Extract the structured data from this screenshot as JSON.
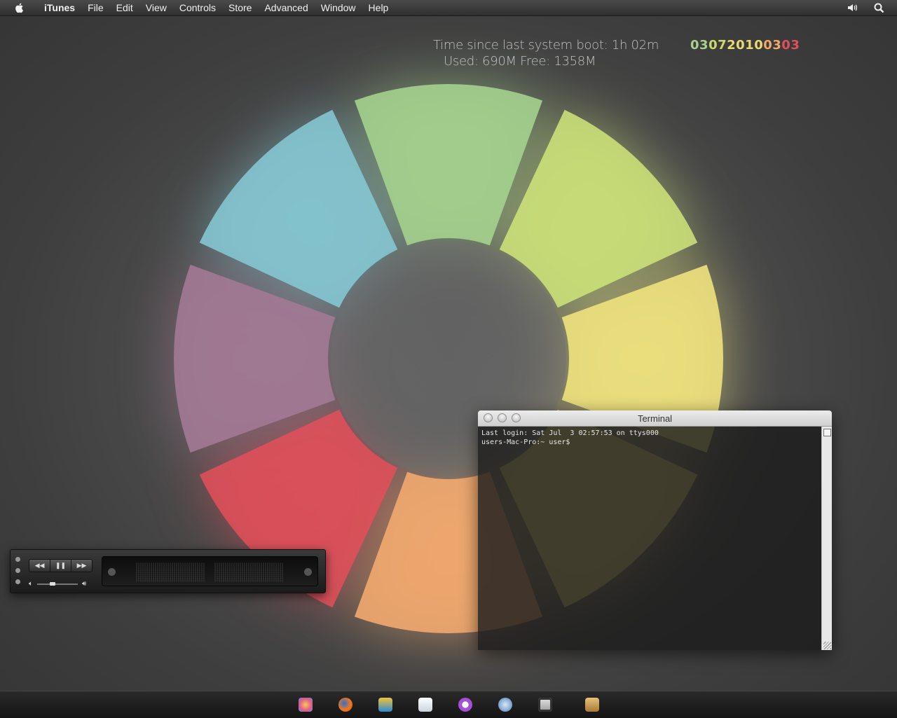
{
  "menubar": {
    "app_name": "iTunes",
    "items": [
      "File",
      "Edit",
      "View",
      "Controls",
      "Store",
      "Advanced",
      "Window",
      "Help"
    ],
    "right_icons": [
      "volume-icon",
      "spotlight-search-icon"
    ]
  },
  "desktop": {
    "uptime": "Time since last system boot: 1h 02m",
    "memory": "Used: 690M Free: 1358M",
    "date_code": [
      {
        "text": "03",
        "color": "#a7d08e"
      },
      {
        "text": "07",
        "color": "#cbd96a"
      },
      {
        "text": "2010",
        "color": "#e8dc70"
      },
      {
        "text": "03",
        "color": "#f2a867"
      },
      {
        "text": "03",
        "color": "#e0505a"
      }
    ],
    "flower_petal_colors": [
      "#a6d490",
      "#cde27a",
      "#f1e57e",
      "#f0d97a",
      "#f5ab6f",
      "#e0505a",
      "#a47a95",
      "#85c8d4"
    ]
  },
  "terminal": {
    "title": "Terminal",
    "lines": [
      "Last login: Sat Jul  3 02:57:53 on ttys000",
      "users-Mac-Pro:~ user$"
    ]
  },
  "miniplayer": {
    "buttons": [
      "rewind-icon",
      "pause-icon",
      "fast-forward-icon"
    ],
    "volume_level": 0.35
  },
  "dock": {
    "items": [
      "pinwheel-app-icon",
      "firefox-icon",
      "photo-viewer-icon",
      "mail-icon",
      "chat-icon",
      "globe-sync-icon",
      "terminal-icon",
      "archive-icon"
    ]
  }
}
